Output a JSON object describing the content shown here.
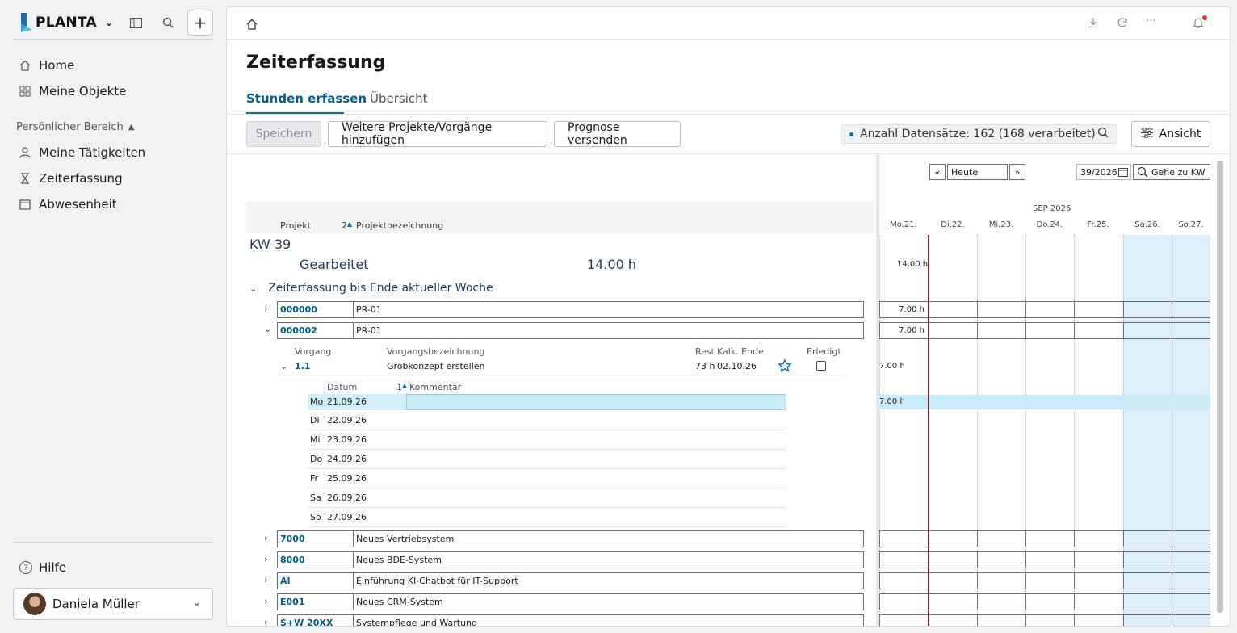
{
  "sidebar": {
    "logo_text": "PLANTA",
    "nav": [
      {
        "label": "Home",
        "icon": "home-icon"
      },
      {
        "label": "Meine Objekte",
        "icon": "grid-icon"
      }
    ],
    "section_label": "Persönlicher Bereich",
    "personal": [
      {
        "label": "Meine Tätigkeiten",
        "icon": "person-icon"
      },
      {
        "label": "Zeiterfassung",
        "icon": "hourglass-icon"
      },
      {
        "label": "Abwesenheit",
        "icon": "calendar-icon"
      }
    ],
    "help_label": "Hilfe",
    "user_name": "Daniela Müller"
  },
  "page": {
    "title": "Zeiterfassung",
    "tabs": [
      "Stunden erfassen",
      "Übersicht"
    ]
  },
  "toolbar": {
    "save": "Speichern",
    "add_projects": "Weitere Projekte/Vorgänge hinzufügen",
    "send_forecast": "Prognose versenden",
    "records": "Anzahl Datensätze: 162 (168 verarbeitet)",
    "view": "Ansicht"
  },
  "grid": {
    "col_project": "Projekt",
    "sort_index": "2",
    "col_project_name": "Projektbezeichnung",
    "kw": "KW 39",
    "worked_label": "Gearbeitet",
    "worked_value": "14.00 h",
    "group_label": "Zeiterfassung bis Ende aktueller Woche",
    "projects_top": [
      {
        "id": "000000",
        "name": "PR-01",
        "hours": "7.00 h"
      },
      {
        "id": "000002",
        "name": "PR-01",
        "hours": "7.00 h"
      }
    ],
    "task_headers": {
      "vorgang": "Vorgang",
      "bez": "Vorgangsbezeichnung",
      "rest": "Rest",
      "kalk_ende": "Kalk. Ende",
      "erledigt": "Erledigt"
    },
    "task": {
      "id": "1.1",
      "name": "Grobkonzept erstellen",
      "rest": "73 h",
      "kalk_ende": "02.10.26",
      "hours": "7.00 h"
    },
    "day_headers": {
      "datum": "Datum",
      "sort_index": "1",
      "kommentar": "Kommentar"
    },
    "days": [
      {
        "wd": "Mo",
        "date": "21.09.26"
      },
      {
        "wd": "Di",
        "date": "22.09.26"
      },
      {
        "wd": "Mi",
        "date": "23.09.26"
      },
      {
        "wd": "Do",
        "date": "24.09.26"
      },
      {
        "wd": "Fr",
        "date": "25.09.26"
      },
      {
        "wd": "Sa",
        "date": "26.09.26"
      },
      {
        "wd": "So",
        "date": "27.09.26"
      }
    ],
    "day_hours": "7.00 h",
    "projects_bottom": [
      {
        "id": "7000",
        "name": "Neues Vertriebsystem"
      },
      {
        "id": "8000",
        "name": "Neues BDE-System"
      },
      {
        "id": "AI",
        "name": "Einführung KI-Chatbot für IT-Support"
      },
      {
        "id": "E001",
        "name": "Neues CRM-System"
      },
      {
        "id": "S+W 20XX",
        "name": "Systempflege und Wartung"
      }
    ]
  },
  "calendar": {
    "prev": "«",
    "today": "Heute",
    "next": "»",
    "week": "39/2026",
    "goto": "Gehe zu KW",
    "month": "SEP 2026",
    "days": [
      "Mo.21.",
      "Di.22.",
      "Mi.23.",
      "Do.24.",
      "Fr.25.",
      "Sa.26.",
      "So.27."
    ],
    "worked_total": "14.00 h"
  }
}
